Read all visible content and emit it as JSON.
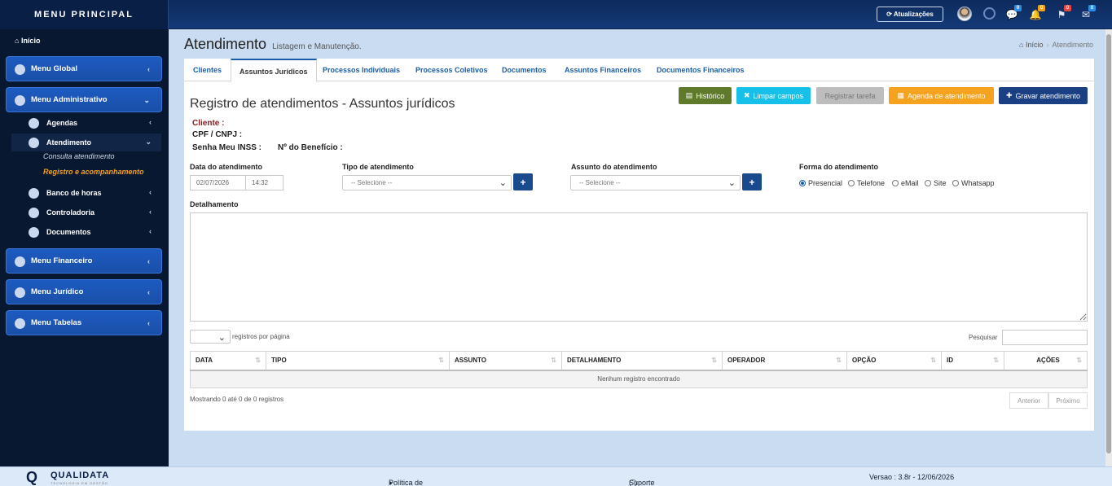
{
  "topbar": {
    "brand": "MENU PRINCIPAL",
    "updates_label": "Atualizações",
    "badges": {
      "msgs": "0",
      "alerts": "0",
      "flags": "0",
      "tasks": "0"
    }
  },
  "sidebar": {
    "home": "Início",
    "menus": [
      {
        "label": "Menu Global"
      },
      {
        "label": "Menu Administrativo"
      },
      {
        "label": "Menu Financeiro"
      },
      {
        "label": "Menu Jurídico"
      },
      {
        "label": "Menu Tabelas"
      }
    ],
    "admin_sub": [
      {
        "label": "Agendas"
      },
      {
        "label": "Atendimento"
      },
      {
        "label": "Banco de horas"
      },
      {
        "label": "Controladoria"
      },
      {
        "label": "Documentos"
      }
    ],
    "atendimento_sub": [
      "Consulta atendimento",
      "Registro e acompanhamento"
    ]
  },
  "page": {
    "title": "Atendimento",
    "subtitle": "Listagem e Manutenção.",
    "crumb_home": "Início",
    "crumb_current": "Atendimento"
  },
  "tabs": [
    "Clientes",
    "Assuntos Jurídicos",
    "Processos Individuais",
    "Processos Coletivos",
    "Documentos",
    "Assuntos Financeiros",
    "Documentos Financeiros"
  ],
  "buttons": {
    "historico": "Histórico",
    "limpar": "Limpar campos",
    "registrar": "Registrar tarefa",
    "agenda": "Agenda de atendimento",
    "gravar": "Gravar atendimento"
  },
  "form": {
    "heading": "Registro de atendimentos - Assuntos jurídicos",
    "cliente": "Cliente :",
    "cpf": "CPF / CNPJ :",
    "senha": "Senha Meu INSS :",
    "beneficio": "Nº do Benefício :",
    "data_label": "Data do atendimento",
    "data_value": "02/07/2026",
    "hora_value": "14:32",
    "tipo_label": "Tipo de atendimento",
    "tipo_value": "-- Selecione --",
    "assunto_label": "Assunto do atendimento",
    "assunto_value": "-- Selecione --",
    "forma_label": "Forma do atendimento",
    "formas": [
      "Presencial",
      "Telefone",
      "eMail",
      "Site",
      "Whatsapp"
    ],
    "detalhamento_label": "Detalhamento"
  },
  "table": {
    "per_page_label": "registros por página",
    "search_label": "Pesquisar",
    "columns": [
      "DATA",
      "TIPO",
      "ASSUNTO",
      "DETALHAMENTO",
      "OPERADOR",
      "OPÇÃO",
      "ID",
      "AÇÕES"
    ],
    "empty": "Nenhum registro encontrado",
    "info": "Mostrando 0 até 0 de 0 registros",
    "prev": "Anterior",
    "next": "Próximo"
  },
  "footer": {
    "logo": "QUALIDATA",
    "tagline": "TECNOLOGIA EM GESTÃO",
    "privacy": "Política de Privacidade",
    "support": "Suporte via WhatsApp",
    "version": "Versao : 3.8r - 12/06/2026"
  },
  "colors": {
    "historico": "#5e7a2a",
    "limpar": "#17c0e8",
    "registrar": "#bdbdbd",
    "agenda": "#f5a21e",
    "gravar": "#1a3f82"
  }
}
